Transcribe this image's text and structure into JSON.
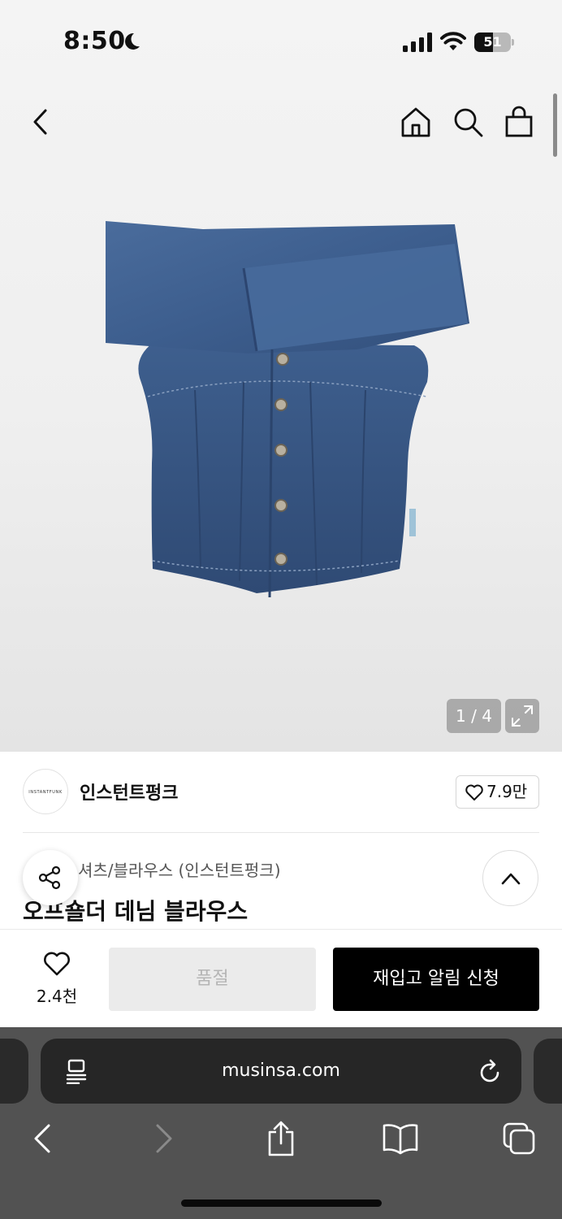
{
  "status_bar": {
    "time": "8:50",
    "battery_level": "51",
    "battery_fraction": 0.51
  },
  "gallery": {
    "counter": "1 / 4"
  },
  "brand": {
    "logo_text": "INSTANTFUNK",
    "name": "인스턴트펑크",
    "like_count": "7.9만"
  },
  "product": {
    "category": "셔츠/블라우스 (인스턴트펑크)",
    "title": "오프숄더 데님 블라우스"
  },
  "purchase_bar": {
    "wish_count": "2.4천",
    "soldout_label": "품절",
    "restock_label": "재입고 알림 신청"
  },
  "browser": {
    "url": "musinsa.com"
  },
  "colors": {
    "denim": "#3f5f8e",
    "button_black": "#000000",
    "soldout_bg": "#ebebeb",
    "browser_bg": "#525252"
  }
}
